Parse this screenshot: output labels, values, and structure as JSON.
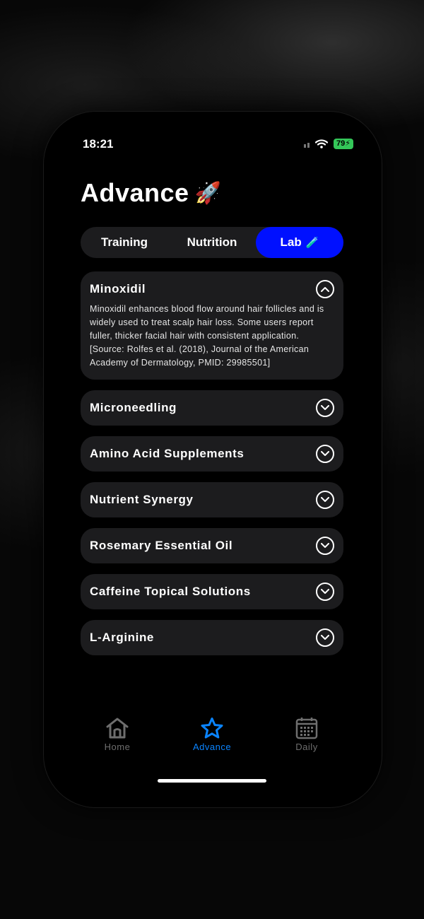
{
  "status": {
    "time": "18:21",
    "battery": "79"
  },
  "header": {
    "title": "Advance",
    "title_emoji": "🚀"
  },
  "tabs": [
    {
      "label": "Training",
      "active": false
    },
    {
      "label": "Nutrition",
      "active": false
    },
    {
      "label": "Lab",
      "active": true,
      "emoji": "🧪"
    }
  ],
  "accordion": [
    {
      "title": "Minoxidil",
      "expanded": true,
      "body": "Minoxidil enhances blood flow around hair follicles and is widely used to treat scalp hair loss. Some users report fuller, thicker facial hair with consistent application. [Source: Rolfes et al. (2018), Journal of the American Academy of Dermatology, PMID: 29985501]"
    },
    {
      "title": "Microneedling",
      "expanded": false
    },
    {
      "title": "Amino Acid Supplements",
      "expanded": false
    },
    {
      "title": "Nutrient Synergy",
      "expanded": false
    },
    {
      "title": "Rosemary Essential Oil",
      "expanded": false
    },
    {
      "title": "Caffeine Topical Solutions",
      "expanded": false
    },
    {
      "title": "L-Arginine",
      "expanded": false
    }
  ],
  "tab_bar": [
    {
      "label": "Home",
      "icon": "home-icon",
      "active": false
    },
    {
      "label": "Advance",
      "icon": "star-icon",
      "active": true
    },
    {
      "label": "Daily",
      "icon": "calendar-icon",
      "active": false
    }
  ],
  "colors": {
    "accent": "#0a84ff",
    "segment_active": "#0010ff",
    "battery": "#34c759",
    "card": "#1c1c1e"
  }
}
